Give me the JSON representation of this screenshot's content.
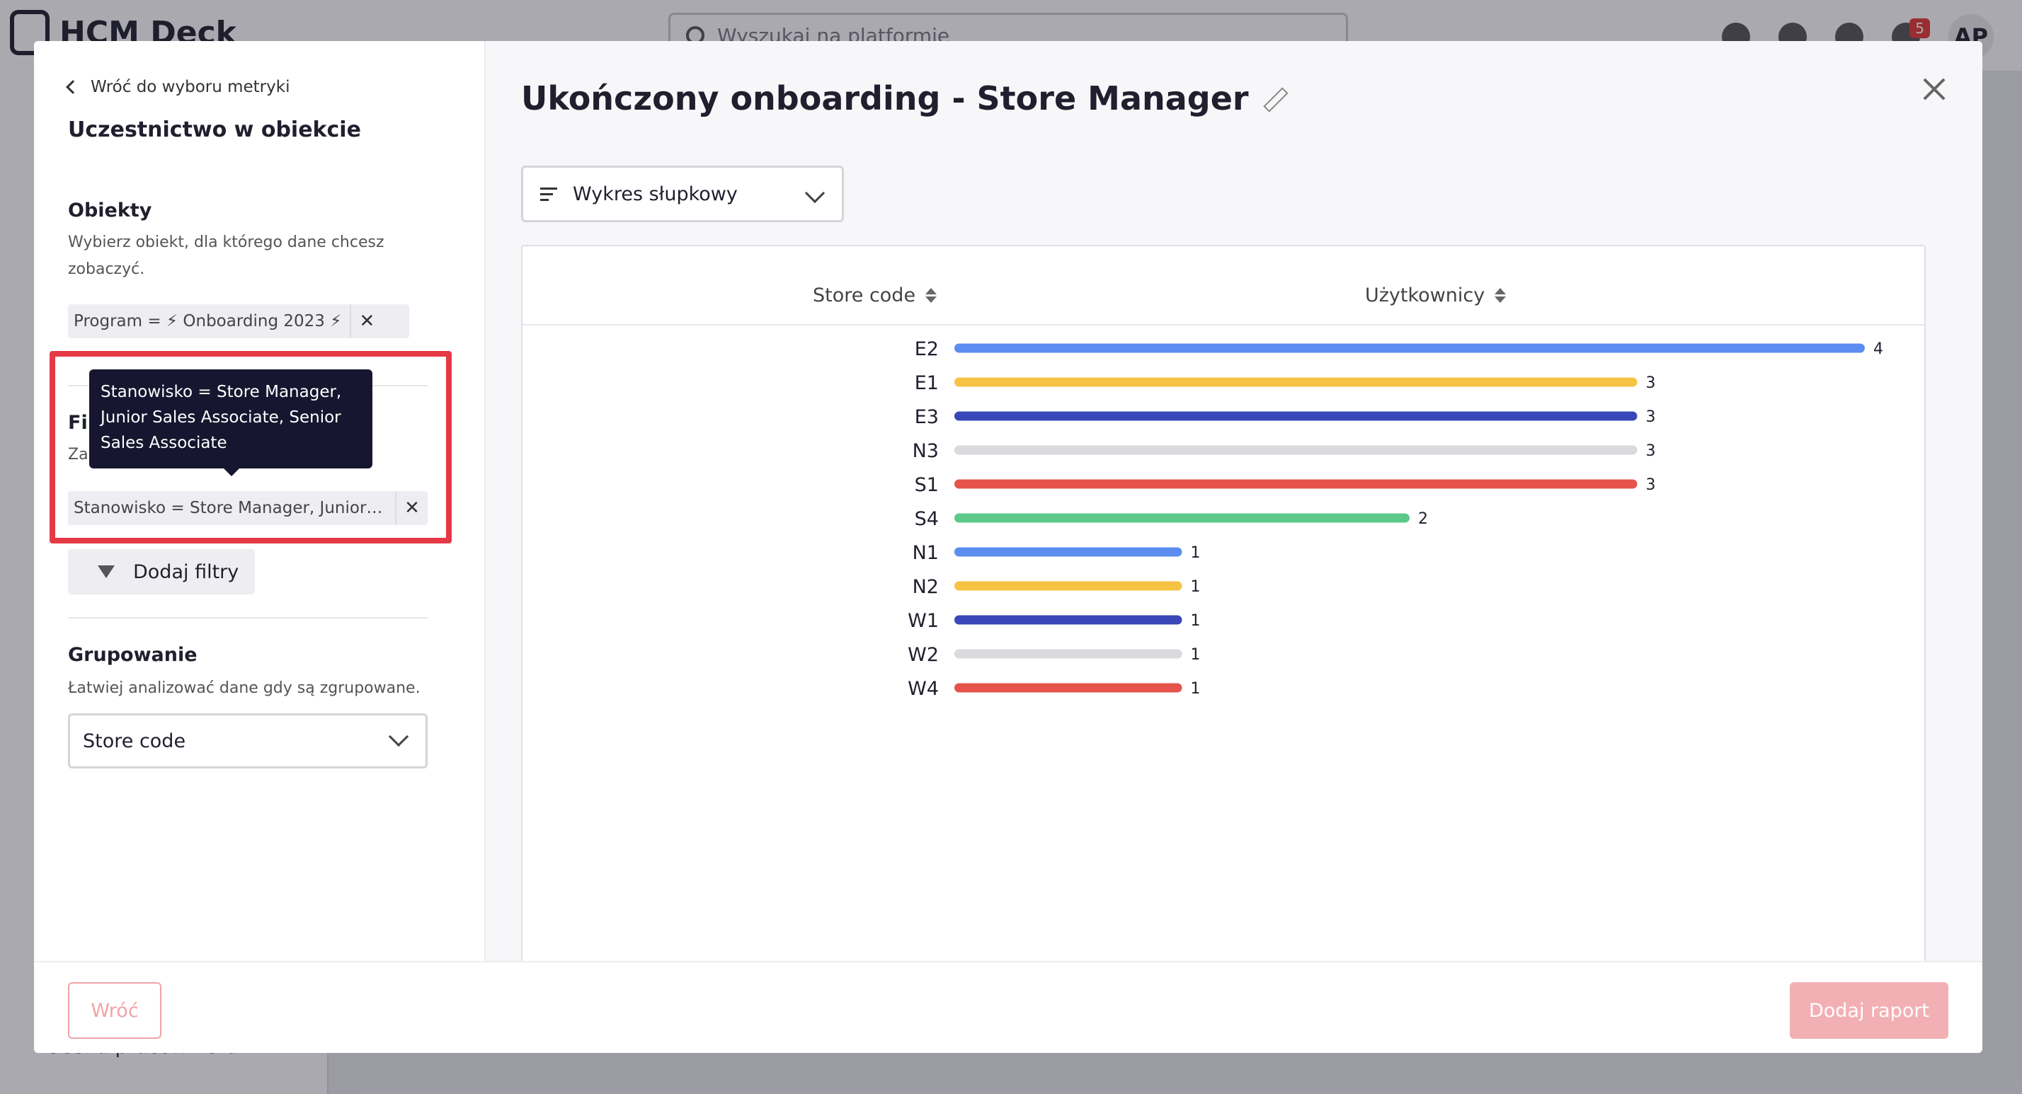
{
  "background": {
    "logo_text": "HCM Deck",
    "search_placeholder": "Wyszukaj na platformie",
    "notification_count": "5",
    "avatar_initials": "AP",
    "sidebar_bottom_text": "Ocena pracownicza"
  },
  "left_panel": {
    "back_link": "Wróć do wyboru metryki",
    "metric_title": "Uczestnictwo w obiekcie",
    "objects": {
      "title": "Obiekty",
      "description": "Wybierz obiekt, dla którego dane chcesz zobaczyć.",
      "tag": "Program = ⚡ Onboarding 2023 ⚡"
    },
    "filters": {
      "title_partial": "Fil",
      "description_partial": "Za",
      "tag": "Stanowisko = Store Manager, Junior Sal...",
      "tooltip": "Stanowisko = Store Manager, Junior Sales Associate, Senior Sales Associate",
      "add_button": "Dodaj filtry"
    },
    "grouping": {
      "title": "Grupowanie",
      "description": "Łatwiej analizować dane gdy są zgrupowane.",
      "selected": "Store code"
    }
  },
  "right_panel": {
    "title": "Ukończony onboarding - Store Manager",
    "chart_type": "Wykres słupkowy",
    "columns": {
      "group": "Store code",
      "value": "Użytkownicy"
    }
  },
  "footer": {
    "back_button": "Wróć",
    "add_button": "Dodaj raport"
  },
  "chart_data": {
    "type": "bar",
    "orientation": "horizontal",
    "categories": [
      "E2",
      "E1",
      "E3",
      "N3",
      "S1",
      "S4",
      "N1",
      "N2",
      "W1",
      "W2",
      "W4"
    ],
    "values": [
      4,
      3,
      3,
      3,
      3,
      2,
      1,
      1,
      1,
      1,
      1
    ],
    "colors": [
      "#5b8ef0",
      "#f6c343",
      "#3a47b8",
      "#d9d9de",
      "#e5534b",
      "#5cc989",
      "#5b8ef0",
      "#f6c343",
      "#3a47b8",
      "#d9d9de",
      "#e5534b"
    ],
    "xlim": [
      0,
      4
    ]
  }
}
